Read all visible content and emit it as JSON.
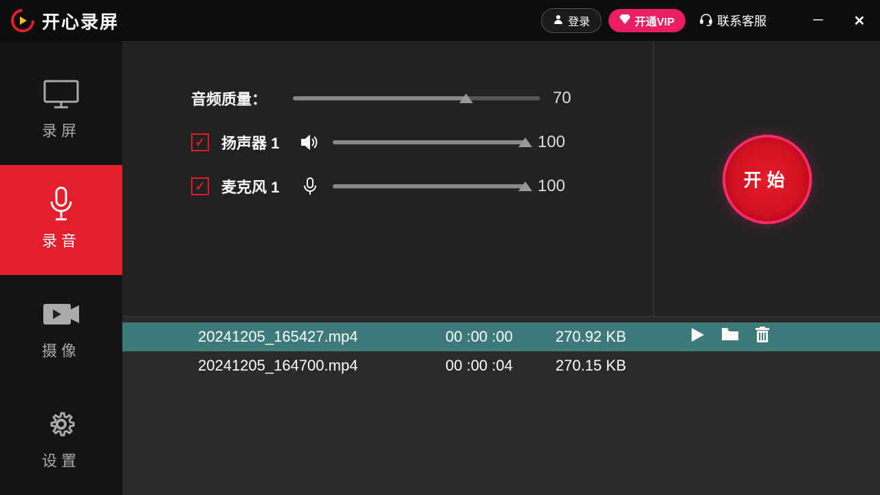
{
  "app": {
    "title": "开心录屏"
  },
  "titlebar": {
    "login": "登录",
    "vip": "开通VIP",
    "support": "联系客服"
  },
  "sidebar": {
    "items": [
      {
        "label": "录屏"
      },
      {
        "label": "录音"
      },
      {
        "label": "摄像"
      },
      {
        "label": "设置"
      }
    ]
  },
  "settings": {
    "quality_label": "音频质量：",
    "quality_value": "70",
    "speaker_label": "扬声器 1",
    "speaker_value": "100",
    "mic_label": "麦克风 1",
    "mic_value": "100",
    "start_label": "开始"
  },
  "files": [
    {
      "name": "20241205_165427.mp4",
      "time": "00 :00 :00",
      "size": "270.92 KB"
    },
    {
      "name": "20241205_164700.mp4",
      "time": "00 :00 :04",
      "size": "270.15 KB"
    }
  ]
}
